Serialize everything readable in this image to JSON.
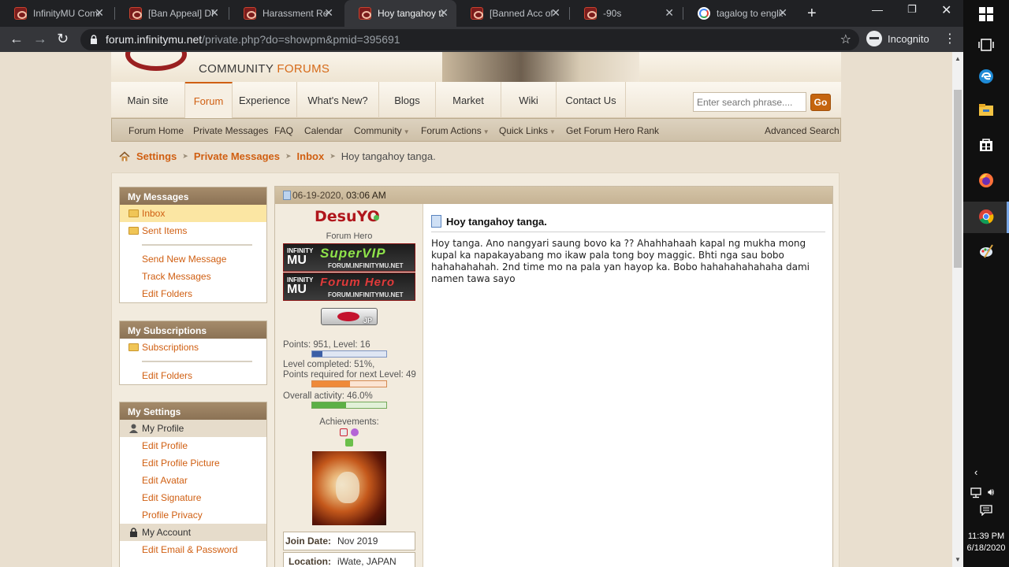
{
  "browser": {
    "tabs": [
      {
        "title": "InfinityMU Comm",
        "favicon": "infinitymu-favicon"
      },
      {
        "title": "[Ban Appeal] DF",
        "favicon": "infinitymu-favicon"
      },
      {
        "title": "Harassment Repo",
        "favicon": "infinitymu-favicon"
      },
      {
        "title": "Hoy tangahoy ta",
        "favicon": "infinitymu-favicon",
        "active": true
      },
      {
        "title": "[Banned Acc of C",
        "favicon": "infinitymu-favicon"
      },
      {
        "title": "-90s",
        "favicon": "infinitymu-favicon"
      },
      {
        "title": "tagalog to englis",
        "favicon": "google-favicon"
      }
    ],
    "url_host": "forum.infinitymu.net",
    "url_path": "/private.php?do=showpm&pmid=395691",
    "incognito_label": "Incognito"
  },
  "header": {
    "community_prefix": "COMMUNITY",
    "community_suffix": "FORUMS"
  },
  "nav": {
    "tabs": [
      "Main site",
      "Forum",
      "Experience",
      "What's New?",
      "Blogs",
      "Market",
      "Wiki",
      "Contact Us"
    ],
    "search_placeholder": "Enter search phrase....",
    "go_label": "Go"
  },
  "subnav": {
    "items": [
      "Forum Home",
      "Private Messages",
      "FAQ",
      "Calendar",
      "Community",
      "Forum Actions",
      "Quick Links",
      "Get Forum Hero Rank"
    ],
    "advanced_search": "Advanced Search"
  },
  "breadcrumb": {
    "settings": "Settings",
    "private_messages": "Private Messages",
    "inbox": "Inbox",
    "current": "Hoy tangahoy tanga."
  },
  "sidebar": {
    "my_messages": {
      "title": "My Messages",
      "inbox": "Inbox",
      "sent": "Sent Items",
      "send_new": "Send New Message",
      "track": "Track Messages",
      "edit_folders": "Edit Folders"
    },
    "my_subscriptions": {
      "title": "My Subscriptions",
      "subscriptions": "Subscriptions",
      "edit_folders": "Edit Folders"
    },
    "my_settings": {
      "title": "My Settings",
      "my_profile": "My Profile",
      "edit_profile": "Edit Profile",
      "edit_profile_picture": "Edit Profile Picture",
      "edit_avatar": "Edit Avatar",
      "edit_signature": "Edit Signature",
      "profile_privacy": "Profile Privacy",
      "my_account": "My Account",
      "edit_email_password": "Edit Email & Password"
    }
  },
  "post": {
    "date": "06-19-2020,",
    "time": "03:06 AM",
    "username": "DesuYO",
    "user_title": "Forum Hero",
    "rank1_big": "SuperVIP",
    "rank1_small": "FORUM.INFINITYMU.NET",
    "rank2_big": "Forum Hero",
    "rank2_small": "FORUM.INFINITYMU.NET",
    "rank_logo_top": "INFINITY",
    "rank_logo_mu": "MU",
    "flag_code": "JP",
    "points_line": "Points: 951, Level: 16",
    "level_pct": 0.14,
    "level_completed_line": "Level completed: 51%,",
    "points_required_line": "Points required for next Level: 49",
    "completed_pct": 0.51,
    "activity_line": "Overall activity: 46.0%",
    "activity_pct": 0.46,
    "achievements_label": "Achievements:",
    "join_date_label": "Join Date:",
    "join_date": "Nov 2019",
    "location_label": "Location:",
    "location": "iWate, JAPAN",
    "message_title": "Hoy tangahoy tanga.",
    "message_lines": [
      "Hoy tanga. Ano nangyari saung bovo ka ?? Ahahhahaah kapal ng mukha mong",
      "kupal ka napakayabang mo ikaw pala tong boy maggic. Bhti nga sau bobo",
      "hahahahahah. 2nd time mo na pala yan hayop ka. Bobo hahahahahahaha dami",
      "namen tawa sayo"
    ]
  },
  "taskbar": {
    "time": "11:39 PM",
    "date": "6/18/2020"
  },
  "colors": {
    "accent": "#d05f12",
    "username": "#b0161c",
    "panel_header": "#8b7255"
  }
}
